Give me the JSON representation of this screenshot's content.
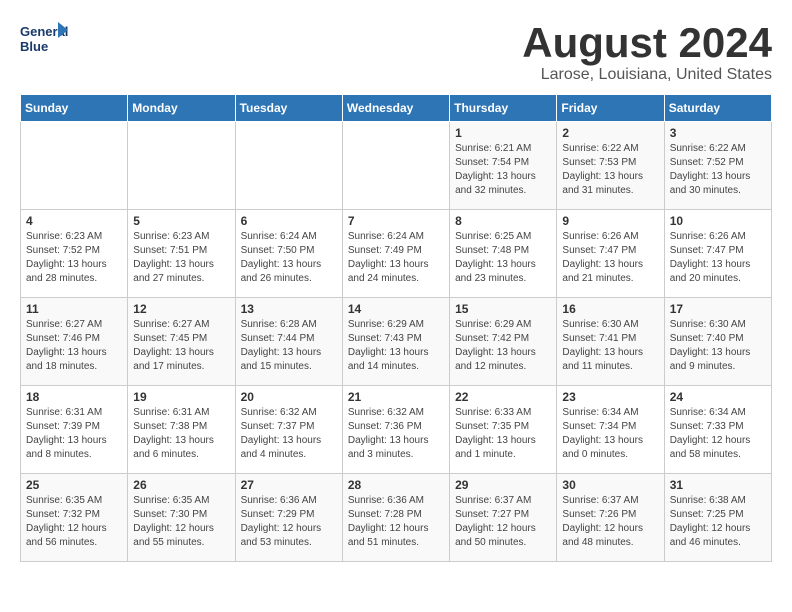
{
  "logo": {
    "line1": "General",
    "line2": "Blue"
  },
  "title": "August 2024",
  "subtitle": "Larose, Louisiana, United States",
  "days_of_week": [
    "Sunday",
    "Monday",
    "Tuesday",
    "Wednesday",
    "Thursday",
    "Friday",
    "Saturday"
  ],
  "weeks": [
    [
      {
        "day": "",
        "info": ""
      },
      {
        "day": "",
        "info": ""
      },
      {
        "day": "",
        "info": ""
      },
      {
        "day": "",
        "info": ""
      },
      {
        "day": "1",
        "info": "Sunrise: 6:21 AM\nSunset: 7:54 PM\nDaylight: 13 hours\nand 32 minutes."
      },
      {
        "day": "2",
        "info": "Sunrise: 6:22 AM\nSunset: 7:53 PM\nDaylight: 13 hours\nand 31 minutes."
      },
      {
        "day": "3",
        "info": "Sunrise: 6:22 AM\nSunset: 7:52 PM\nDaylight: 13 hours\nand 30 minutes."
      }
    ],
    [
      {
        "day": "4",
        "info": "Sunrise: 6:23 AM\nSunset: 7:52 PM\nDaylight: 13 hours\nand 28 minutes."
      },
      {
        "day": "5",
        "info": "Sunrise: 6:23 AM\nSunset: 7:51 PM\nDaylight: 13 hours\nand 27 minutes."
      },
      {
        "day": "6",
        "info": "Sunrise: 6:24 AM\nSunset: 7:50 PM\nDaylight: 13 hours\nand 26 minutes."
      },
      {
        "day": "7",
        "info": "Sunrise: 6:24 AM\nSunset: 7:49 PM\nDaylight: 13 hours\nand 24 minutes."
      },
      {
        "day": "8",
        "info": "Sunrise: 6:25 AM\nSunset: 7:48 PM\nDaylight: 13 hours\nand 23 minutes."
      },
      {
        "day": "9",
        "info": "Sunrise: 6:26 AM\nSunset: 7:47 PM\nDaylight: 13 hours\nand 21 minutes."
      },
      {
        "day": "10",
        "info": "Sunrise: 6:26 AM\nSunset: 7:47 PM\nDaylight: 13 hours\nand 20 minutes."
      }
    ],
    [
      {
        "day": "11",
        "info": "Sunrise: 6:27 AM\nSunset: 7:46 PM\nDaylight: 13 hours\nand 18 minutes."
      },
      {
        "day": "12",
        "info": "Sunrise: 6:27 AM\nSunset: 7:45 PM\nDaylight: 13 hours\nand 17 minutes."
      },
      {
        "day": "13",
        "info": "Sunrise: 6:28 AM\nSunset: 7:44 PM\nDaylight: 13 hours\nand 15 minutes."
      },
      {
        "day": "14",
        "info": "Sunrise: 6:29 AM\nSunset: 7:43 PM\nDaylight: 13 hours\nand 14 minutes."
      },
      {
        "day": "15",
        "info": "Sunrise: 6:29 AM\nSunset: 7:42 PM\nDaylight: 13 hours\nand 12 minutes."
      },
      {
        "day": "16",
        "info": "Sunrise: 6:30 AM\nSunset: 7:41 PM\nDaylight: 13 hours\nand 11 minutes."
      },
      {
        "day": "17",
        "info": "Sunrise: 6:30 AM\nSunset: 7:40 PM\nDaylight: 13 hours\nand 9 minutes."
      }
    ],
    [
      {
        "day": "18",
        "info": "Sunrise: 6:31 AM\nSunset: 7:39 PM\nDaylight: 13 hours\nand 8 minutes."
      },
      {
        "day": "19",
        "info": "Sunrise: 6:31 AM\nSunset: 7:38 PM\nDaylight: 13 hours\nand 6 minutes."
      },
      {
        "day": "20",
        "info": "Sunrise: 6:32 AM\nSunset: 7:37 PM\nDaylight: 13 hours\nand 4 minutes."
      },
      {
        "day": "21",
        "info": "Sunrise: 6:32 AM\nSunset: 7:36 PM\nDaylight: 13 hours\nand 3 minutes."
      },
      {
        "day": "22",
        "info": "Sunrise: 6:33 AM\nSunset: 7:35 PM\nDaylight: 13 hours\nand 1 minute."
      },
      {
        "day": "23",
        "info": "Sunrise: 6:34 AM\nSunset: 7:34 PM\nDaylight: 13 hours\nand 0 minutes."
      },
      {
        "day": "24",
        "info": "Sunrise: 6:34 AM\nSunset: 7:33 PM\nDaylight: 12 hours\nand 58 minutes."
      }
    ],
    [
      {
        "day": "25",
        "info": "Sunrise: 6:35 AM\nSunset: 7:32 PM\nDaylight: 12 hours\nand 56 minutes."
      },
      {
        "day": "26",
        "info": "Sunrise: 6:35 AM\nSunset: 7:30 PM\nDaylight: 12 hours\nand 55 minutes."
      },
      {
        "day": "27",
        "info": "Sunrise: 6:36 AM\nSunset: 7:29 PM\nDaylight: 12 hours\nand 53 minutes."
      },
      {
        "day": "28",
        "info": "Sunrise: 6:36 AM\nSunset: 7:28 PM\nDaylight: 12 hours\nand 51 minutes."
      },
      {
        "day": "29",
        "info": "Sunrise: 6:37 AM\nSunset: 7:27 PM\nDaylight: 12 hours\nand 50 minutes."
      },
      {
        "day": "30",
        "info": "Sunrise: 6:37 AM\nSunset: 7:26 PM\nDaylight: 12 hours\nand 48 minutes."
      },
      {
        "day": "31",
        "info": "Sunrise: 6:38 AM\nSunset: 7:25 PM\nDaylight: 12 hours\nand 46 minutes."
      }
    ]
  ]
}
